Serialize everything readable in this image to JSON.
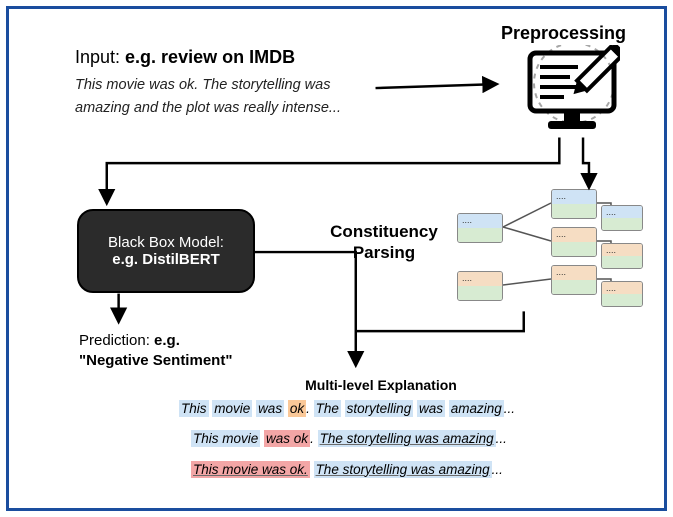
{
  "preprocessing": {
    "label": "Preprocessing"
  },
  "input": {
    "prefix": "Input: ",
    "title_bold": "e.g. review on IMDB",
    "example": "This movie was ok. The storytelling was amazing and the plot was really intense..."
  },
  "blackbox": {
    "line1": "Black Box Model:",
    "line2": "e.g. DistilBERT"
  },
  "constituency": {
    "line1": "Constituency",
    "line2": "Parsing"
  },
  "prediction": {
    "prefix": "Prediction: ",
    "bold": "e.g.",
    "value": "\"Negative Sentiment\""
  },
  "multilevel": {
    "title": "Multi-level Explanation"
  },
  "explanations": {
    "row1": {
      "w1": "This",
      "w2": "movie",
      "w3": "was",
      "w4": "ok",
      "p1": ".",
      "w5": "The",
      "w6": "storytelling",
      "w7": "was",
      "w8": "amazing",
      "suffix": "..."
    },
    "row2": {
      "g1": "This movie",
      "g2": "was ok",
      "p1": ".",
      "g3": "The storytelling was amazing",
      "suffix": "..."
    },
    "row3": {
      "s1": "This movie was ok.",
      "s2": "The storytelling was amazing",
      "suffix": "..."
    }
  },
  "tree_node_text": "....",
  "icons": {
    "computer": "computer-edit-icon"
  },
  "colors": {
    "frame": "#1a4d9e",
    "blue_hl": "#cfe3f5",
    "orange_hl": "#fac898",
    "red_hl": "#f3a6a6",
    "green_node": "#d7ebd2",
    "orange_node": "#f6ddc3"
  }
}
